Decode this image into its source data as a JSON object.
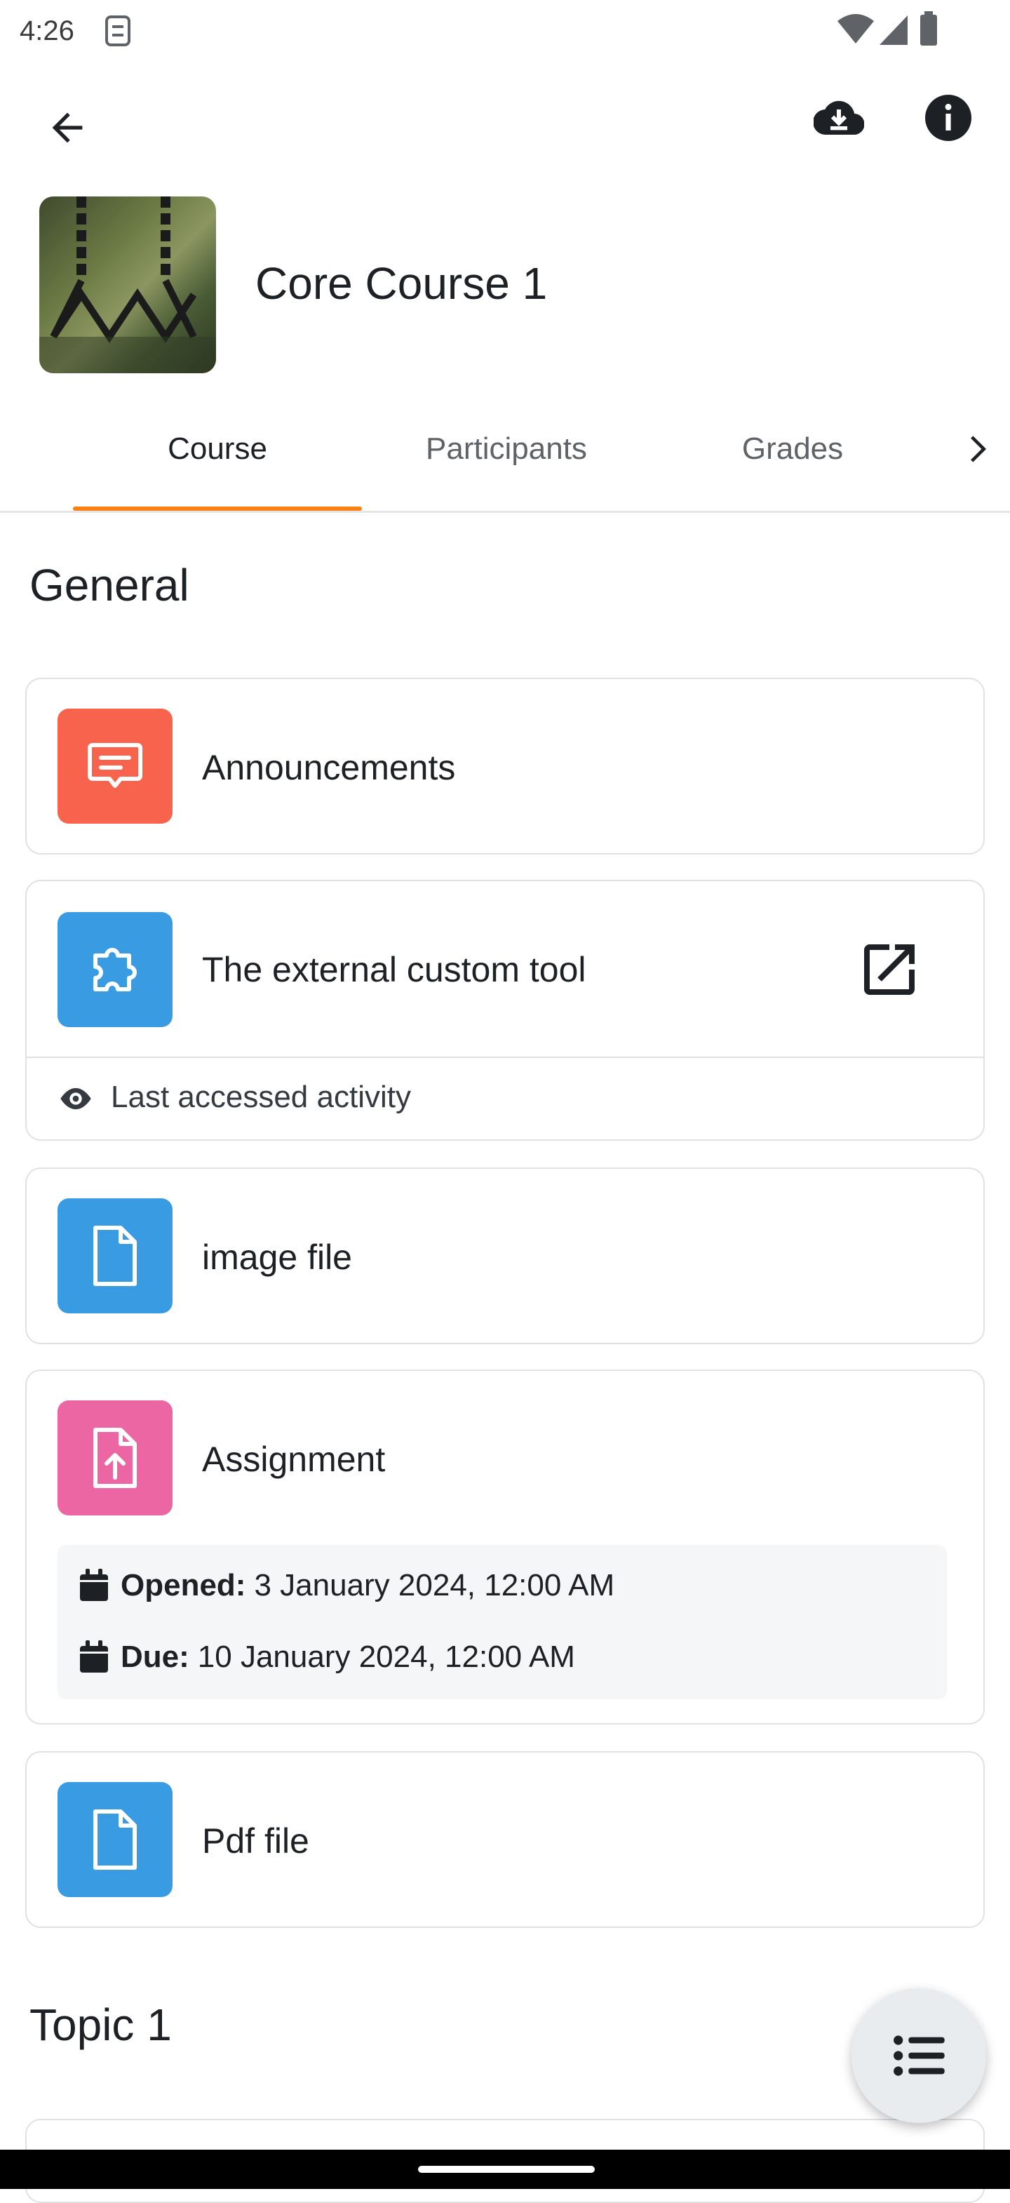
{
  "status_bar": {
    "time": "4:26"
  },
  "header": {
    "course_title": "Core Course 1"
  },
  "tabs": [
    {
      "label": "Course",
      "active": true
    },
    {
      "label": "Participants",
      "active": false
    },
    {
      "label": "Grades",
      "active": false
    }
  ],
  "sections": {
    "general": {
      "title": "General"
    },
    "topic1": {
      "title": "Topic 1"
    }
  },
  "modules": {
    "announcements": {
      "name": "Announcements"
    },
    "external_tool": {
      "name": "The external custom tool",
      "note": "Last accessed activity"
    },
    "image_file": {
      "name": "image file"
    },
    "assignment": {
      "name": "Assignment",
      "opened_label": "Opened:",
      "opened_value": "3 January 2024, 12:00 AM",
      "due_label": "Due:",
      "due_value": "10 January 2024, 12:00 AM"
    },
    "pdf_file": {
      "name": "Pdf file"
    }
  },
  "colors": {
    "accent": "#f98012",
    "announcements_icon_bg": "#f7634d",
    "tool_icon_bg": "#399be2",
    "file_icon_bg": "#399be2",
    "assignment_icon_bg": "#eb66a2"
  }
}
